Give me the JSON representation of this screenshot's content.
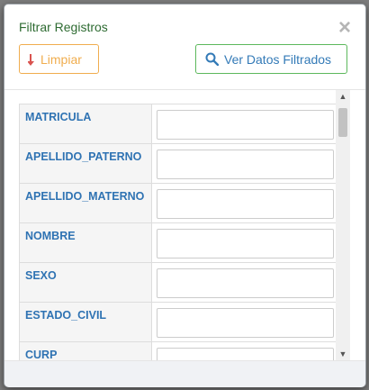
{
  "modal": {
    "title": "Filtrar Registros",
    "close_label": "×",
    "clear_button": "Limpiar",
    "view_button": "Ver Datos Filtrados"
  },
  "fields": [
    {
      "label": "MATRICULA",
      "value": ""
    },
    {
      "label": "APELLIDO_PATERNO",
      "value": ""
    },
    {
      "label": "APELLIDO_MATERNO",
      "value": ""
    },
    {
      "label": "NOMBRE",
      "value": ""
    },
    {
      "label": "SEXO",
      "value": ""
    },
    {
      "label": "ESTADO_CIVIL",
      "value": ""
    },
    {
      "label": "CURP",
      "value": ""
    }
  ],
  "colors": {
    "title": "#2e6b32",
    "clear_accent": "#f0ad4e",
    "view_border": "#5cb85c",
    "label_text": "#2f73b3"
  },
  "icons": {
    "clear": "arrow-down-icon",
    "view": "search-icon",
    "scroll_up": "scroll-up-arrow-icon",
    "scroll_down": "scroll-down-arrow-icon"
  }
}
